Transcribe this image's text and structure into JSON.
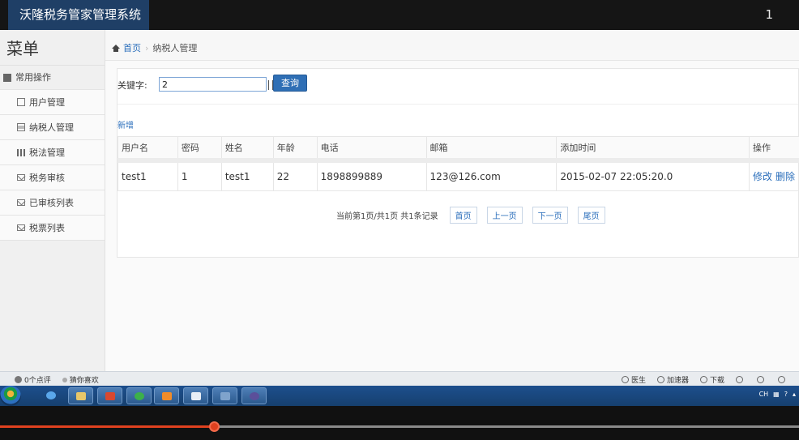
{
  "app": {
    "title": "沃隆税务管家管理系统",
    "top_right": "1"
  },
  "sidebar": {
    "title": "菜单",
    "group": "常用操作",
    "items": [
      {
        "label": "用户管理",
        "icon": "file-icon"
      },
      {
        "label": "纳税人管理",
        "icon": "list-icon"
      },
      {
        "label": "税法管理",
        "icon": "bar-chart-icon"
      },
      {
        "label": "税务审核",
        "icon": "envelope-icon"
      },
      {
        "label": "已审核列表",
        "icon": "envelope-icon"
      },
      {
        "label": "税票列表",
        "icon": "envelope-icon"
      }
    ]
  },
  "breadcrumb": {
    "home": "首页",
    "current": "纳税人管理"
  },
  "search": {
    "label": "关键字:",
    "value": "2",
    "button": "查询"
  },
  "add_link": "新增",
  "table": {
    "headers": [
      "用户名",
      "密码",
      "姓名",
      "年龄",
      "电话",
      "邮箱",
      "添加时间",
      "操作"
    ],
    "rows": [
      {
        "cells": [
          "test1",
          "1",
          "test1",
          "22",
          "1898899889",
          "123@126.com",
          "2015-02-07 22:05:20.0"
        ],
        "actions": [
          "修改",
          "删除"
        ]
      }
    ]
  },
  "pager": {
    "info": "当前第1页/共1页 共1条记录",
    "first": "首页",
    "prev": "上一页",
    "next": "下一页",
    "last": "尾页"
  },
  "browser_status": {
    "left": [
      "0个点评",
      "猜你喜欢"
    ],
    "right": [
      "医生",
      "加速器",
      "下载"
    ]
  },
  "taskbar": {
    "tray_text": "CH"
  },
  "player": {
    "progress": 0.268
  },
  "colors": {
    "brand": "#1f3f66",
    "link": "#2a6ebb",
    "button": "#2f6fb5",
    "progress": "#e0411f"
  }
}
